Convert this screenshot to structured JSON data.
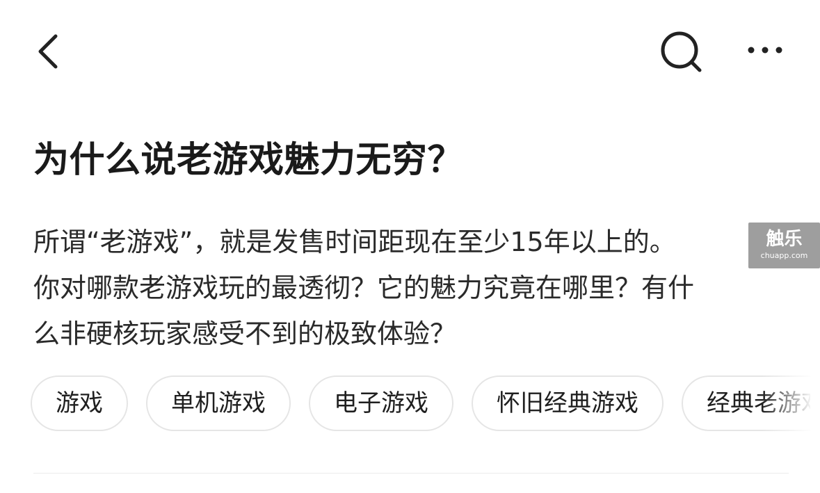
{
  "topbar": {
    "back_icon": "chevron-left-icon",
    "search_icon": "search-icon",
    "more_icon": "more-horizontal-icon"
  },
  "question": {
    "title": "为什么说老游戏魅力无穷？",
    "description_lines": [
      "所谓“老游戏”，就是发售时间距现在至少15年以上的。",
      "你对哪款老游戏玩的最透彻？它的魅力究竟在哪里？有什",
      "么非硬核玩家感受不到的极致体验？"
    ]
  },
  "tags": [
    "游戏",
    "单机游戏",
    "电子游戏",
    "怀旧经典游戏",
    "经典老游戏"
  ],
  "watermark": {
    "brand": "触乐",
    "domain": "chuapp.com"
  }
}
